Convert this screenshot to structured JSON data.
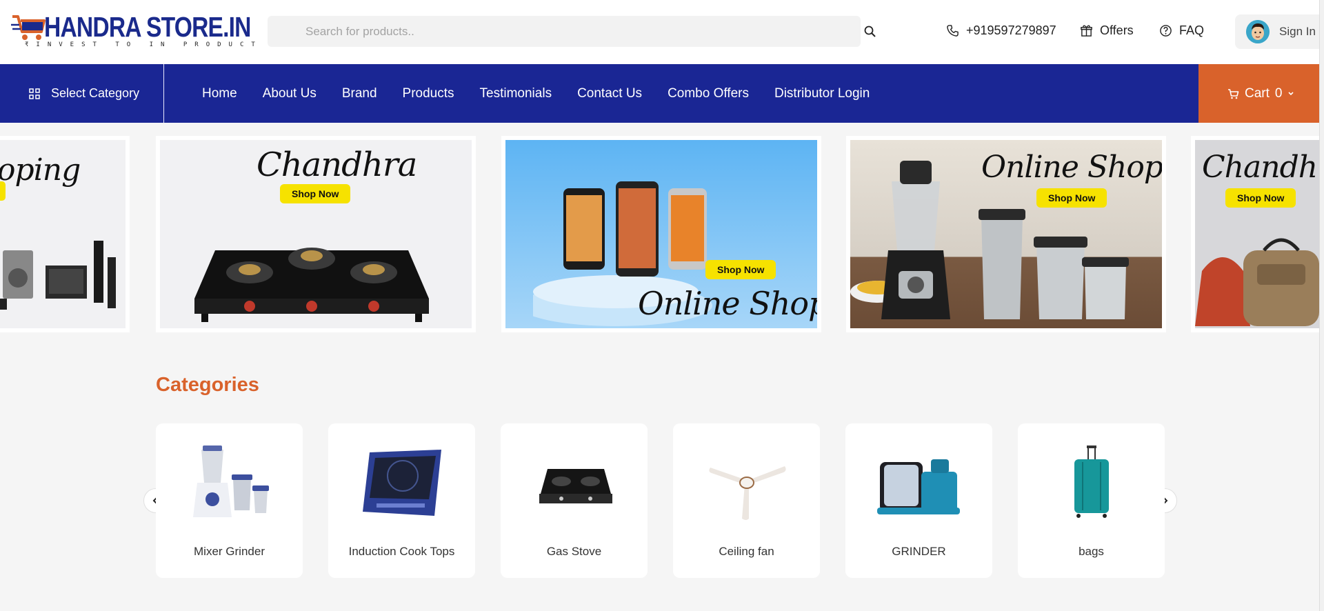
{
  "header": {
    "logo_text": "HANDRA STORE.IN",
    "logo_tagline": "₹INVEST TO IN PRODUCT",
    "search_placeholder": "Search for products..",
    "phone": "+919597279897",
    "offers_label": "Offers",
    "faq_label": "FAQ",
    "signin_label": "Sign In"
  },
  "nav": {
    "select_category": "Select Category",
    "items": [
      "Home",
      "About Us",
      "Brand",
      "Products",
      "Testimonials",
      "Contact Us",
      "Combo Offers",
      "Distributor Login"
    ],
    "cart_label": "Cart",
    "cart_count": "0"
  },
  "banners": [
    {
      "script": "oping",
      "cta": ""
    },
    {
      "script": "Chandhra",
      "cta": "Shop Now"
    },
    {
      "script": "Online Shoping",
      "cta": "Shop Now"
    },
    {
      "script": "Online Shoping",
      "cta": "Shop Now"
    },
    {
      "script": "Chandhra",
      "cta": "Shop Now"
    }
  ],
  "categories": {
    "title": "Categories",
    "items": [
      {
        "label": "Mixer Grinder",
        "icon": "mixer-grinder-image"
      },
      {
        "label": "Induction Cook Tops",
        "icon": "induction-cooktop-image"
      },
      {
        "label": "Gas Stove",
        "icon": "gas-stove-image"
      },
      {
        "label": "Ceiling fan",
        "icon": "ceiling-fan-image"
      },
      {
        "label": "GRINDER",
        "icon": "wet-grinder-image"
      },
      {
        "label": "bags",
        "icon": "suitcase-image"
      }
    ]
  },
  "colors": {
    "nav_bg": "#1a2694",
    "accent": "#d9622b",
    "cta_yellow": "#f6e200"
  }
}
